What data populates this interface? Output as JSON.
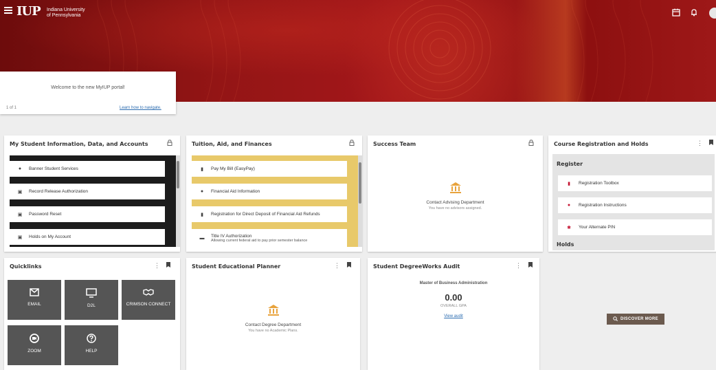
{
  "header": {
    "logo_mark": "IUP",
    "logo_line1": "Indiana University",
    "logo_line2": "of Pennsylvania",
    "icons": [
      "menu-icon",
      "calendar-icon",
      "bell-icon",
      "avatar"
    ]
  },
  "welcome": {
    "message": "Welcome to the new MyIUP portal!",
    "pager": "1 of 1",
    "link": "Learn how to navigate."
  },
  "cards": {
    "student_info": {
      "title": "My Student Information, Data, and Accounts",
      "items": [
        {
          "label": "Banner Student Services",
          "icon": "info-icon"
        },
        {
          "label": "Record Release Authorization",
          "icon": "lock-icon"
        },
        {
          "label": "Password Reset",
          "icon": "lock-icon"
        },
        {
          "label": "Holds on My Account",
          "icon": "lock-icon"
        }
      ]
    },
    "tuition": {
      "title": "Tuition, Aid, and Finances",
      "items": [
        {
          "label": "Pay My Bill (EasyPay)",
          "icon": "document-icon"
        },
        {
          "label": "Financial Aid Information",
          "icon": "info-icon"
        },
        {
          "label": "Registration for Direct Deposit of Financial Aid Refunds",
          "icon": "document-icon"
        },
        {
          "label": "Title IV Authorization",
          "sub": "Allowing current federal aid to pay prior semester balance",
          "icon": "card-icon"
        }
      ]
    },
    "success_team": {
      "title": "Success Team",
      "main": "Contact Advising Department",
      "sub": "You have no advisors assigned."
    },
    "course_reg": {
      "title": "Course Registration and Holds",
      "register_heading": "Register",
      "items": [
        {
          "label": "Registration Toolbox",
          "icon": "document-icon"
        },
        {
          "label": "Registration Instructions",
          "icon": "info-icon"
        },
        {
          "label": "Your Alternate PIN",
          "icon": "asterisk-icon"
        }
      ],
      "holds_heading": "Holds"
    },
    "quicklinks": {
      "title": "Quicklinks",
      "tiles": [
        {
          "label": "EMAIL",
          "icon": "email-icon"
        },
        {
          "label": "D2L",
          "icon": "monitor-icon"
        },
        {
          "label": "CRIMSON CONNECT",
          "icon": "handshake-icon"
        },
        {
          "label": "ZOOM",
          "icon": "zoom-icon"
        },
        {
          "label": "HELP",
          "icon": "help-icon"
        }
      ]
    },
    "planner": {
      "title": "Student Educational Planner",
      "main": "Contact Degree Department",
      "sub": "You have no Academic Plans."
    },
    "degreeworks": {
      "title": "Student DegreeWorks Audit",
      "degree": "Master of Business Administration",
      "gpa": "0.00",
      "gpa_label": "OVERALL GPA",
      "link": "View audit"
    },
    "discover": {
      "label": "DISCOVER MORE"
    }
  }
}
